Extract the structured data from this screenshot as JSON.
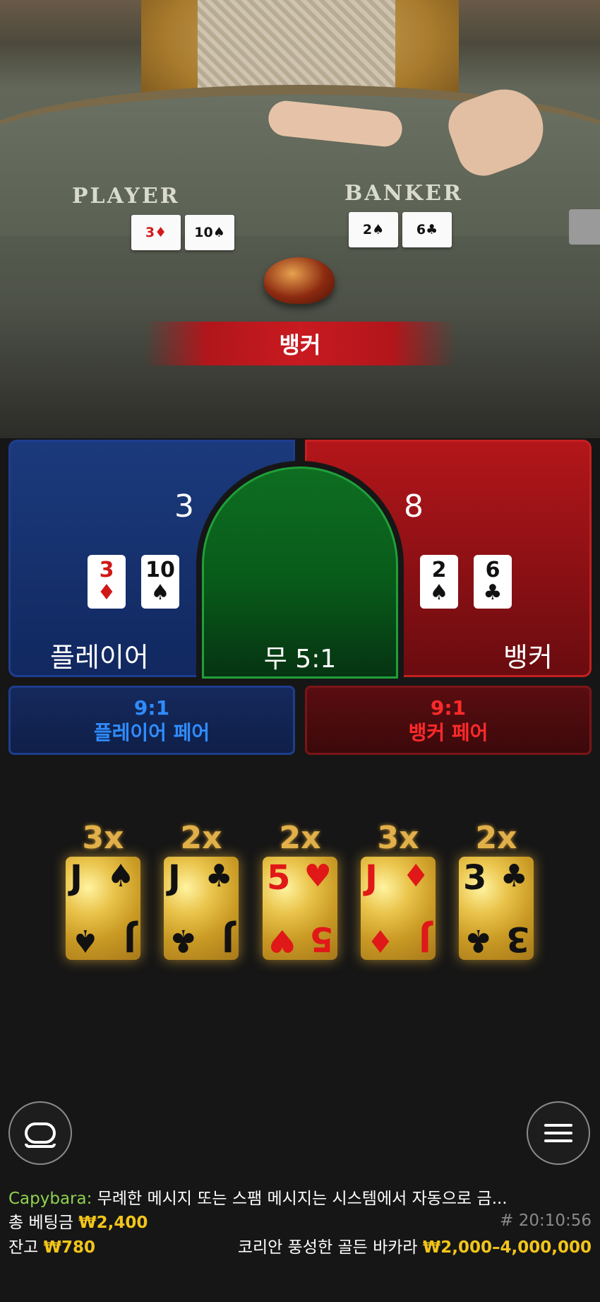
{
  "table_felt": {
    "player_label": "PLAYER",
    "banker_label": "BANKER",
    "player_cards": [
      {
        "rank": "3",
        "suit": "♦",
        "color": "red"
      },
      {
        "rank": "10",
        "suit": "♠",
        "color": "black"
      }
    ],
    "banker_cards": [
      {
        "rank": "2",
        "suit": "♠",
        "color": "black"
      },
      {
        "rank": "6",
        "suit": "♣",
        "color": "black"
      }
    ]
  },
  "result_banner": "뱅커",
  "bets": {
    "player": {
      "score": "3",
      "label": "플레이어",
      "cards": [
        {
          "rank": "3",
          "suit": "♦",
          "color": "red"
        },
        {
          "rank": "10",
          "suit": "♠",
          "color": "black"
        }
      ]
    },
    "banker": {
      "score": "8",
      "label": "뱅커",
      "cards": [
        {
          "rank": "2",
          "suit": "♠",
          "color": "black"
        },
        {
          "rank": "6",
          "suit": "♣",
          "color": "black"
        }
      ]
    },
    "tie": {
      "label": "무 5:1"
    },
    "player_pair": {
      "odds": "9:1",
      "label": "플레이어 페어"
    },
    "banker_pair": {
      "odds": "9:1",
      "label": "뱅커 페어"
    }
  },
  "lucky_cards": [
    {
      "multiplier": "3x",
      "rank": "J",
      "suit": "♠",
      "color": "black"
    },
    {
      "multiplier": "2x",
      "rank": "J",
      "suit": "♣",
      "color": "black"
    },
    {
      "multiplier": "2x",
      "rank": "5",
      "suit": "♥",
      "color": "red"
    },
    {
      "multiplier": "3x",
      "rank": "J",
      "suit": "♦",
      "color": "red"
    },
    {
      "multiplier": "2x",
      "rank": "3",
      "suit": "♣",
      "color": "black"
    }
  ],
  "controls": {
    "chat_icon": "chat-icon",
    "menu_icon": "menu-icon"
  },
  "chat": {
    "user": "Capybara:",
    "message": "무례한 메시지 또는 스팸 메시지는 시스템에서 자동으로 금..."
  },
  "footer": {
    "total_bet_label": "총 베팅금",
    "total_bet_value": "₩2,400",
    "round_id": "# 20:10:56",
    "balance_label": "잔고",
    "balance_value": "₩780",
    "table_name": "코리안 풍성한 골든 바카라",
    "limits": "₩2,000–4,000,000"
  },
  "colors": {
    "player_blue": "#1b3a7c",
    "banker_red": "#b3161a",
    "tie_green": "#0e6e22",
    "gold": "#f2c51a",
    "chat_user_green": "#8fd14f"
  }
}
